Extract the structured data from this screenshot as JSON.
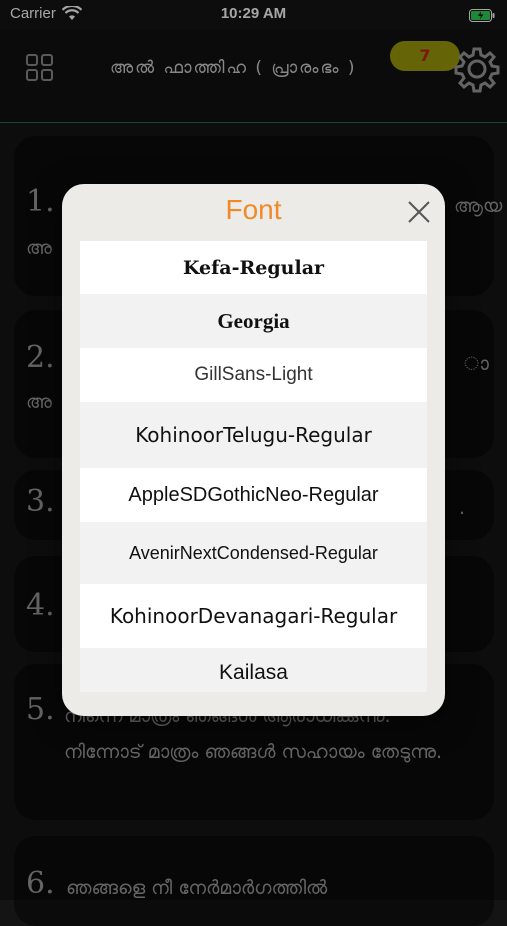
{
  "status_bar": {
    "carrier": "Carrier",
    "time": "10:29 AM"
  },
  "header": {
    "title": "അൽ ഫാത്തിഹ ( പ്രാരംഭം )",
    "badge_count": "7"
  },
  "verses": [
    {
      "number": "1.",
      "text": "ആയ",
      "text2": "അ"
    },
    {
      "number": "2.",
      "text": "ാ",
      "text2": "അ"
    },
    {
      "number": "3.",
      "text": "."
    },
    {
      "number": "4.",
      "text": ""
    },
    {
      "number": "5.",
      "text": "നിന്നെ മാത്രം ഞങ്ങൾ ആരാധിക്കുന്നു. നിന്നോട് മാത്രം ഞങ്ങൾ സഹായം തേടുന്നു."
    },
    {
      "number": "6.",
      "text": "ഞങ്ങളെ നീ നേർമാർഗത്തിൽ"
    }
  ],
  "modal": {
    "title": "Font",
    "fonts": [
      "Kefa-Regular",
      "Georgia",
      "GillSans-Light",
      "KohinoorTelugu-Regular",
      "AppleSDGothicNeo-Regular",
      "AvenirNextCondensed-Regular",
      "KohinoorDevanagari-Regular",
      "Kailasa"
    ]
  },
  "colors": {
    "accent": "#f08a28",
    "badge": "#9b9a0a",
    "badge_text": "#c0231a"
  }
}
